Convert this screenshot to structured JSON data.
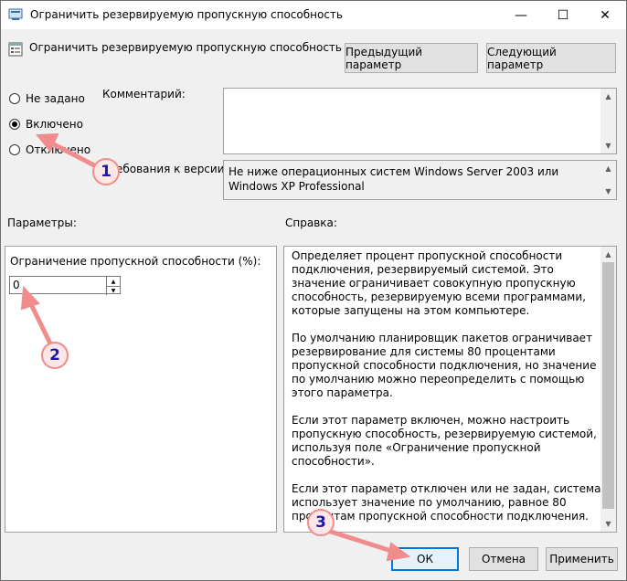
{
  "window": {
    "title": "Ограничить резервируемую пропускную способность",
    "minimize_glyph": "—",
    "maximize_glyph": "☐",
    "close_glyph": "✕"
  },
  "header": {
    "policy_name": "Ограничить резервируемую пропускную способность",
    "prev_button": "Предыдущий параметр",
    "next_button": "Следующий параметр"
  },
  "state": {
    "not_configured": "Не задано",
    "enabled": "Включено",
    "disabled": "Отключено",
    "selected": "enabled"
  },
  "comment": {
    "label": "Комментарий:",
    "value": ""
  },
  "supported": {
    "label": "Требования к версии:",
    "value": "Не ниже операционных систем Windows Server 2003 или Windows XP Professional"
  },
  "params": {
    "label": "Параметры:",
    "field_label": "Ограничение пропускной способности (%):",
    "field_value": "0"
  },
  "help": {
    "label": "Справка:",
    "text": "Определяет процент пропускной способности подключения, резервируемый системой. Это значение ограничивает совокупную пропускную способность, резервируемую всеми программами, которые запущены на этом компьютере.\n\nПо умолчанию планировщик пакетов ограничивает резервирование для системы 80 процентами пропускной способности подключения, но значение по умолчанию можно переопределить с помощью этого параметра.\n\nЕсли этот параметр включен, можно настроить пропускную способность, резервируемую системой, используя поле «Ограничение пропускной способности».\n\nЕсли этот параметр отключен или не задан, система использует значение по умолчанию, равное 80 процентам пропускной способности подключения.\n\nВнимание! Если ограничение пропускной способности для конкретного сетевого адаптера задано в реестре, этот"
  },
  "footer": {
    "ok": "ОК",
    "cancel": "Отмена",
    "apply": "Применить"
  },
  "annotations": [
    "1",
    "2",
    "3"
  ],
  "colors": {
    "annotation_arrow": "#f08c8c",
    "annotation_text": "#1a1aa8",
    "default_button_border": "#0078d7"
  }
}
